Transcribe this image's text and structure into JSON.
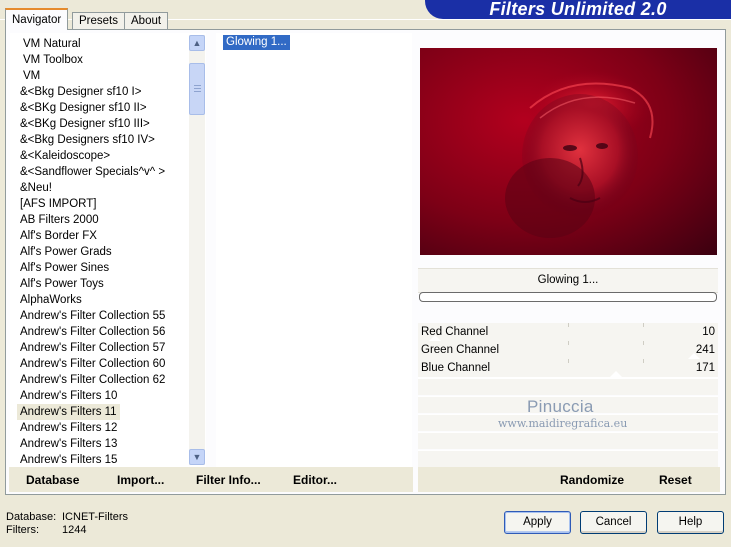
{
  "window": {
    "title": "Filters Unlimited 2.0"
  },
  "tabs": [
    {
      "label": "Navigator",
      "active": true
    },
    {
      "label": "Presets",
      "active": false
    },
    {
      "label": "About",
      "active": false
    }
  ],
  "filter_list": {
    "items": [
      "VM Natural",
      "VM Toolbox",
      "VM",
      "&<Bkg Designer sf10 I>",
      "&<BKg Designer sf10 II>",
      "&<BKg Designer sf10 III>",
      "&<Bkg Designers sf10 IV>",
      "&<Kaleidoscope>",
      "&<Sandflower Specials^v^ >",
      "&Neu!",
      "[AFS IMPORT]",
      "AB Filters 2000",
      "Alf's Border FX",
      "Alf's Power Grads",
      "Alf's Power Sines",
      "Alf's Power Toys",
      "AlphaWorks",
      "Andrew's Filter Collection 55",
      "Andrew's Filter Collection 56",
      "Andrew's Filter Collection 57",
      "Andrew's Filter Collection 60",
      "Andrew's Filter Collection 62",
      "Andrew's Filters 10",
      "Andrew's Filters 11",
      "Andrew's Filters 12",
      "Andrew's Filters 13",
      "Andrew's Filters 15"
    ],
    "selected_index": 23
  },
  "subfilter_list": {
    "items": [
      "Glowing 1..."
    ],
    "selected_index": 0
  },
  "preview": {
    "filter_label": "Glowing 1...",
    "progress": 0
  },
  "channels": [
    {
      "name": "Red Channel",
      "value": "10",
      "level": 10
    },
    {
      "name": "Green Channel",
      "value": "241",
      "level": 241
    },
    {
      "name": "Blue Channel",
      "value": "171",
      "level": 171
    }
  ],
  "watermark": {
    "title": "Pinuccia",
    "site": "www.maidiregrafica.eu"
  },
  "actions": {
    "database": "Database",
    "import": "Import...",
    "filter_info": "Filter Info...",
    "editor": "Editor...",
    "randomize": "Randomize",
    "reset": "Reset"
  },
  "footer": {
    "database_label": "Database:",
    "database_value": "ICNET-Filters",
    "filters_label": "Filters:",
    "filters_value": "1244",
    "apply": "Apply",
    "cancel": "Cancel",
    "help": "Help"
  },
  "colors": {
    "banner": "#1a2fa6",
    "selection": "#316ac5",
    "tab_highlight": "#e68b2c"
  },
  "icons": {
    "scroll_up": "chevron-up-icon",
    "scroll_down": "chevron-down-icon"
  }
}
